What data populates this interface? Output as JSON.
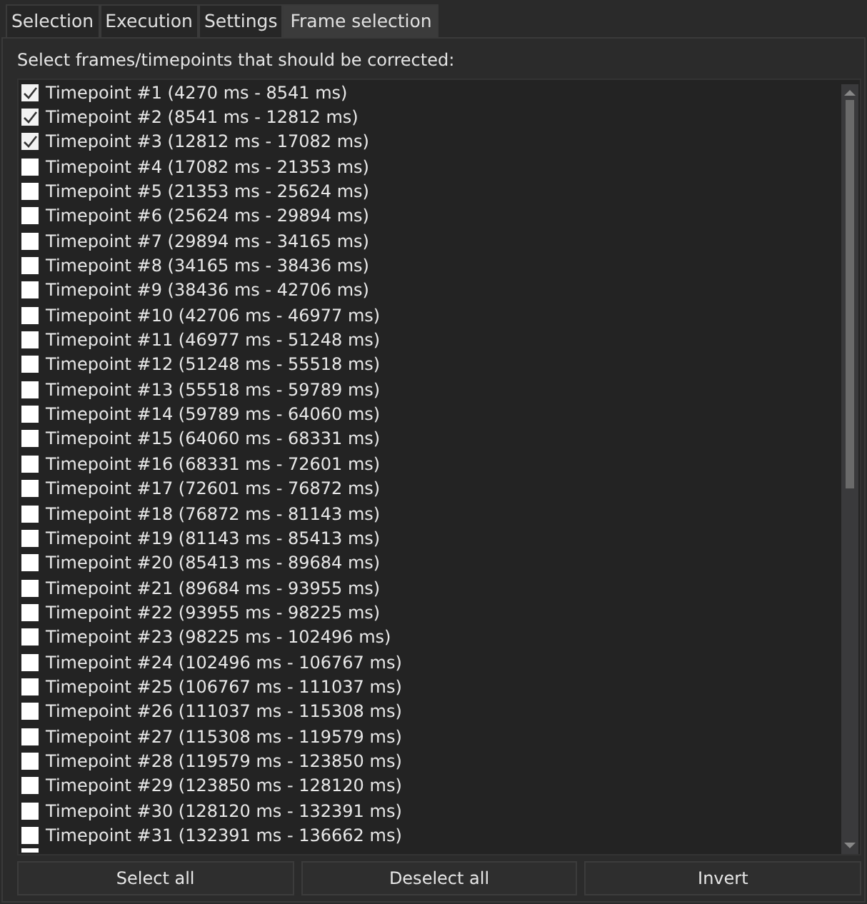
{
  "tabs": [
    {
      "label": "Selection",
      "selected": false
    },
    {
      "label": "Execution",
      "selected": false
    },
    {
      "label": "Settings",
      "selected": false
    },
    {
      "label": "Frame selection",
      "selected": true
    }
  ],
  "prompt": "Select frames/timepoints that should be corrected:",
  "timepoints": [
    {
      "label": "Timepoint #1 (4270 ms - 8541 ms)",
      "checked": true
    },
    {
      "label": "Timepoint #2 (8541 ms - 12812 ms)",
      "checked": true
    },
    {
      "label": "Timepoint #3 (12812 ms - 17082 ms)",
      "checked": true
    },
    {
      "label": "Timepoint #4 (17082 ms - 21353 ms)",
      "checked": false
    },
    {
      "label": "Timepoint #5 (21353 ms - 25624 ms)",
      "checked": false
    },
    {
      "label": "Timepoint #6 (25624 ms - 29894 ms)",
      "checked": false
    },
    {
      "label": "Timepoint #7 (29894 ms - 34165 ms)",
      "checked": false
    },
    {
      "label": "Timepoint #8 (34165 ms - 38436 ms)",
      "checked": false
    },
    {
      "label": "Timepoint #9 (38436 ms - 42706 ms)",
      "checked": false
    },
    {
      "label": "Timepoint #10 (42706 ms - 46977 ms)",
      "checked": false
    },
    {
      "label": "Timepoint #11 (46977 ms - 51248 ms)",
      "checked": false
    },
    {
      "label": "Timepoint #12 (51248 ms - 55518 ms)",
      "checked": false
    },
    {
      "label": "Timepoint #13 (55518 ms - 59789 ms)",
      "checked": false
    },
    {
      "label": "Timepoint #14 (59789 ms - 64060 ms)",
      "checked": false
    },
    {
      "label": "Timepoint #15 (64060 ms - 68331 ms)",
      "checked": false
    },
    {
      "label": "Timepoint #16 (68331 ms - 72601 ms)",
      "checked": false
    },
    {
      "label": "Timepoint #17 (72601 ms - 76872 ms)",
      "checked": false
    },
    {
      "label": "Timepoint #18 (76872 ms - 81143 ms)",
      "checked": false
    },
    {
      "label": "Timepoint #19 (81143 ms - 85413 ms)",
      "checked": false
    },
    {
      "label": "Timepoint #20 (85413 ms - 89684 ms)",
      "checked": false
    },
    {
      "label": "Timepoint #21 (89684 ms - 93955 ms)",
      "checked": false
    },
    {
      "label": "Timepoint #22 (93955 ms - 98225 ms)",
      "checked": false
    },
    {
      "label": "Timepoint #23 (98225 ms - 102496 ms)",
      "checked": false
    },
    {
      "label": "Timepoint #24 (102496 ms - 106767 ms)",
      "checked": false
    },
    {
      "label": "Timepoint #25 (106767 ms - 111037 ms)",
      "checked": false
    },
    {
      "label": "Timepoint #26 (111037 ms - 115308 ms)",
      "checked": false
    },
    {
      "label": "Timepoint #27 (115308 ms - 119579 ms)",
      "checked": false
    },
    {
      "label": "Timepoint #28 (119579 ms - 123850 ms)",
      "checked": false
    },
    {
      "label": "Timepoint #29 (123850 ms - 128120 ms)",
      "checked": false
    },
    {
      "label": "Timepoint #30 (128120 ms - 132391 ms)",
      "checked": false
    },
    {
      "label": "Timepoint #31 (132391 ms - 136662 ms)",
      "checked": false
    }
  ],
  "buttons": [
    "Select all",
    "Deselect all",
    "Invert"
  ]
}
